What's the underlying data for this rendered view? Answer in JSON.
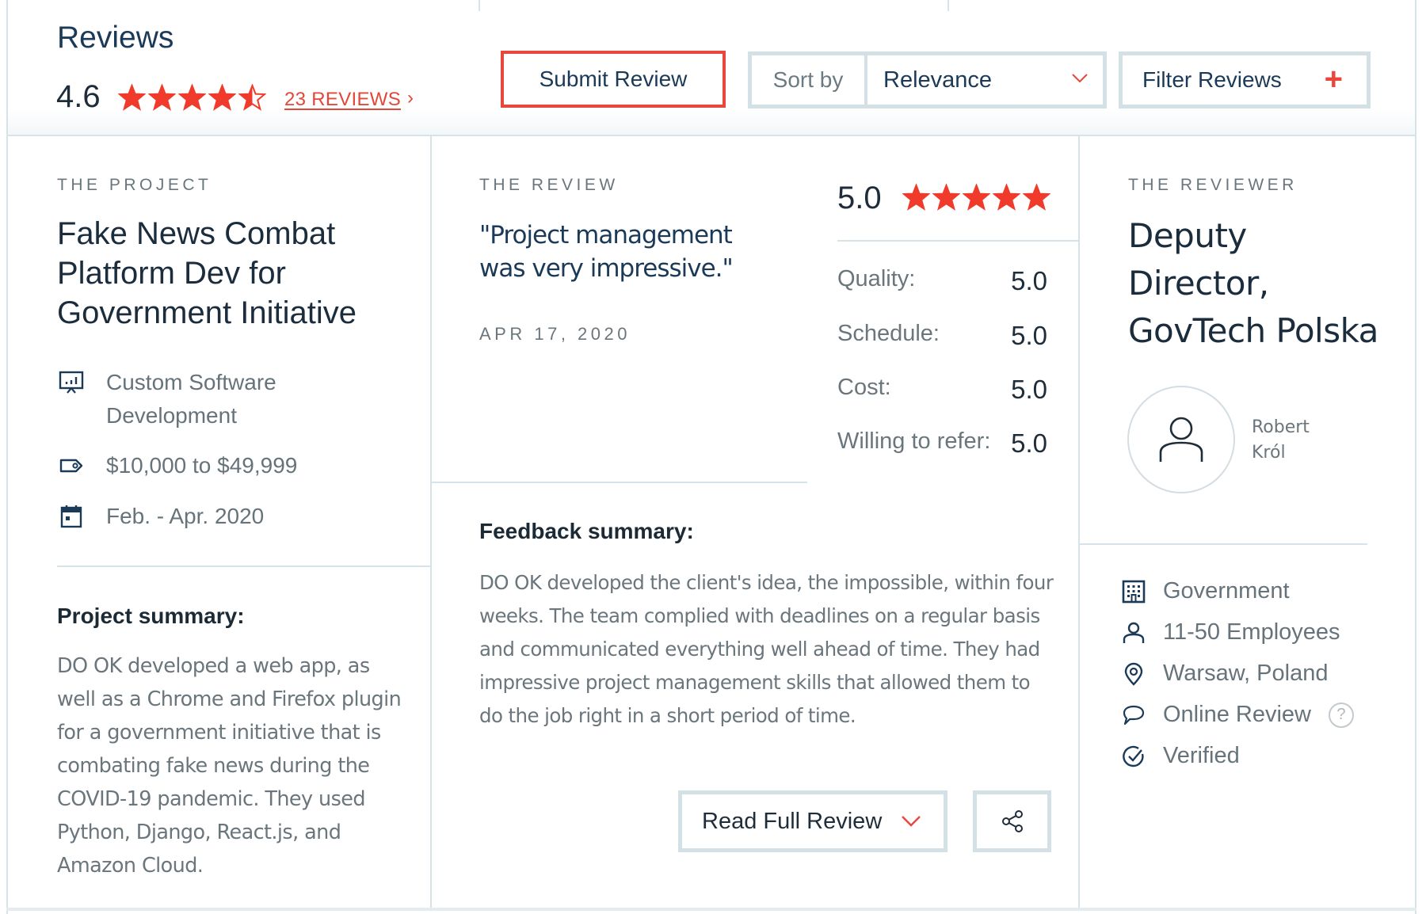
{
  "header": {
    "title": "Reviews",
    "overall_rating": "4.6",
    "overall_stars": 4.6,
    "reviews_link": "23 REVIEWS",
    "reviews_chevron": "›",
    "submit_label": "Submit Review",
    "sort_label": "Sort by",
    "sort_value": "Relevance",
    "filter_label": "Filter Reviews",
    "filter_icon": "+"
  },
  "colors": {
    "accent_red": "#e8473b",
    "star_red": "#ef3a2c",
    "primary_text": "#1b3a57",
    "muted_text": "#6a767c",
    "border": "#d3e1e7"
  },
  "project": {
    "section_label": "THE PROJECT",
    "title": "Fake News Combat Platform Dev for Government Initiative",
    "meta": [
      {
        "icon": "presentation-chart-icon",
        "text": "Custom Software Development"
      },
      {
        "icon": "price-tag-icon",
        "text": "$10,000 to $49,999"
      },
      {
        "icon": "calendar-icon",
        "text": "Feb. - Apr. 2020"
      }
    ],
    "summary_heading": "Project summary:",
    "summary_text": "DO OK developed a web app, as well as a Chrome and Firefox plugin for a government initiative that is combating fake news during the COVID-19 pandemic. They used Python, Django, React.js, and Amazon Cloud."
  },
  "review": {
    "section_label": "THE REVIEW",
    "quote": "\"Project management was very impressive.\"",
    "date": "APR 17, 2020",
    "score": "5.0",
    "score_stars": 5,
    "ratings": [
      {
        "label": "Quality:",
        "value": "5.0"
      },
      {
        "label": "Schedule:",
        "value": "5.0"
      },
      {
        "label": "Cost:",
        "value": "5.0"
      },
      {
        "label": "Willing to refer:",
        "value": "5.0"
      }
    ],
    "feedback_heading": "Feedback summary:",
    "feedback_text": "DO OK developed the client's idea, the impossible, within four weeks. The team complied with deadlines on a regular basis and communicated everything well ahead of time. They had impressive project management skills that allowed them to do the job right in a short period of time.",
    "read_full_label": "Read Full Review"
  },
  "reviewer": {
    "section_label": "THE REVIEWER",
    "title": "Deputy Director, GovTech Polska",
    "name_first": "Robert",
    "name_last": "Król",
    "details": [
      {
        "icon": "building-icon",
        "text": "Government"
      },
      {
        "icon": "user-icon",
        "text": "11-50 Employees"
      },
      {
        "icon": "location-pin-icon",
        "text": "Warsaw, Poland"
      },
      {
        "icon": "speech-bubble-icon",
        "text": "Online Review",
        "help": "?"
      },
      {
        "icon": "verified-check-icon",
        "text": "Verified"
      }
    ]
  }
}
